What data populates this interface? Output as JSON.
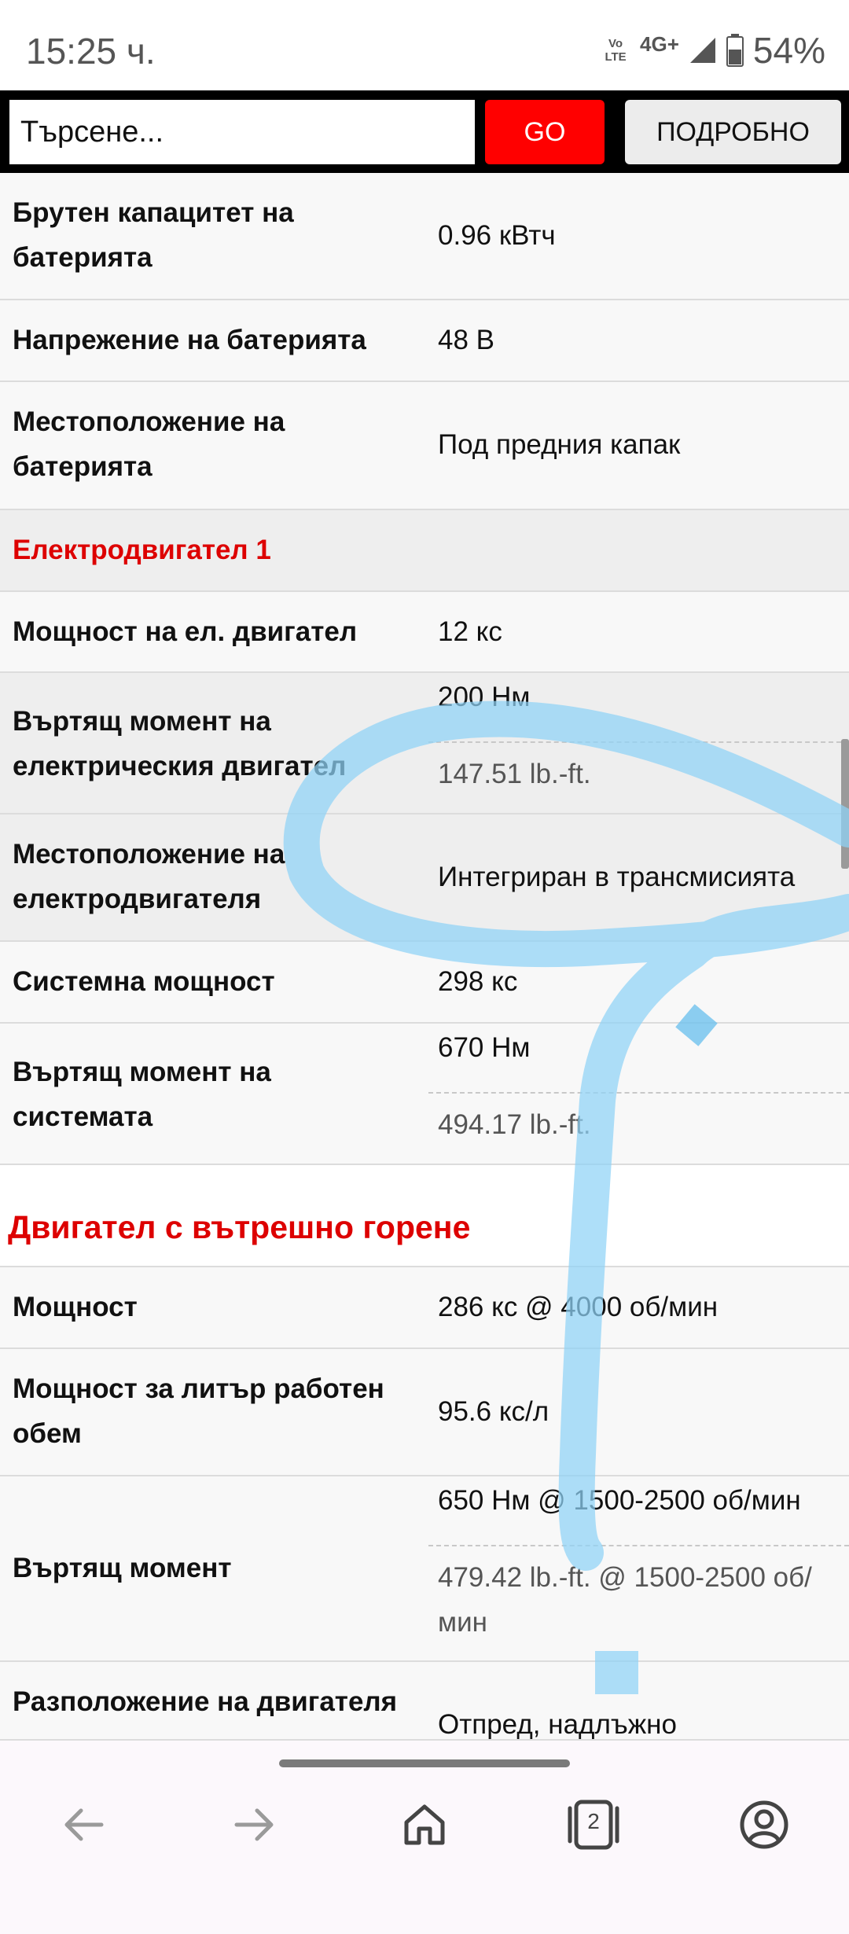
{
  "status_bar": {
    "time": "15:25 ч.",
    "volte_line1": "Vo",
    "volte_line2": "LTE",
    "network": "4G+",
    "battery": "54%"
  },
  "search": {
    "placeholder": "Търсене...",
    "go_label": "GO",
    "details_label": "ПОДРОБНО"
  },
  "rows": [
    {
      "label": "Брутен капацитет на батерията",
      "value": "0.96 кВтч"
    },
    {
      "label": "Напрежение на батерията",
      "value": "48 В"
    },
    {
      "label": "Местоположение на батерията",
      "value": "Под предния капак"
    },
    {
      "section": "Електродвигател 1"
    },
    {
      "label": "Мощност на ел. двигател",
      "value": "12 кс"
    },
    {
      "label": "Въртящ момент на електрическия двигател",
      "value": "200 Нм",
      "value_alt": "147.51 lb.-ft."
    },
    {
      "label": "Местоположение на електродвигателя",
      "value": "Интегриран в трансмисията"
    },
    {
      "label": "Системна мощност",
      "value": "298 кс"
    },
    {
      "label": "Въртящ момент на системата",
      "value": "670 Нм",
      "value_alt": "494.17 lb.-ft."
    },
    {
      "heading": "Двигател с вътрешно горене"
    },
    {
      "label": "Мощност",
      "value": "286 кс @ 4000 об/мин"
    },
    {
      "label": "Мощност за литър работен обем",
      "value": "95.6 кс/л"
    },
    {
      "label": "Въртящ момент",
      "value": "650 Нм @ 1500-2500 об/мин",
      "value_alt": "479.42 lb.-ft. @ 1500-2500 об/мин"
    },
    {
      "label": "Разположение на двигателя",
      "value": "Отпред, надлъжно"
    }
  ],
  "bottom_nav": {
    "tab_count": "2",
    "items": [
      "back-icon",
      "forward-icon",
      "home-icon",
      "tabs-icon",
      "account-icon"
    ]
  },
  "colors": {
    "accent_red": "#ff0000",
    "heading_red": "#dd0000",
    "ink_blue": "#8fd3f6"
  }
}
